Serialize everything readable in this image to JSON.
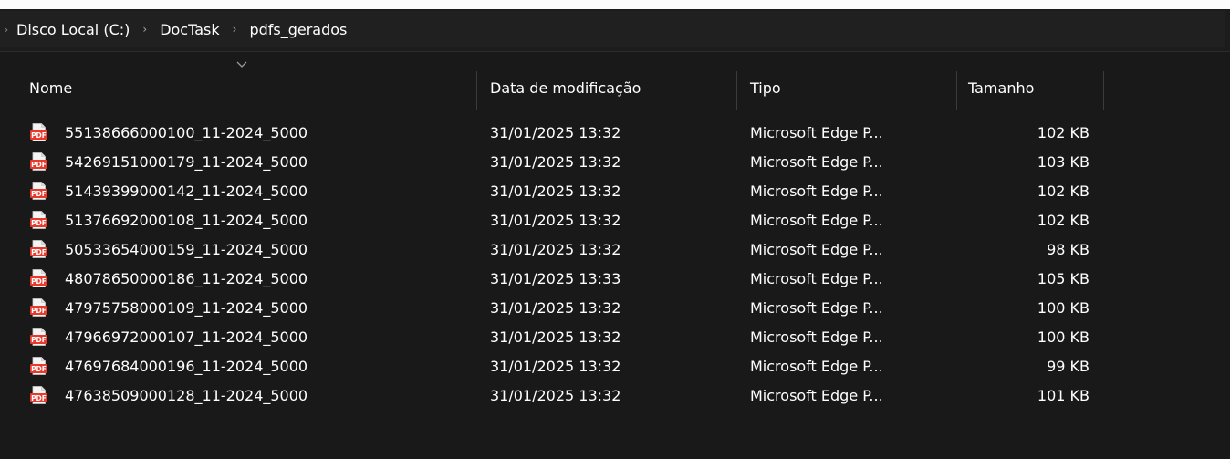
{
  "breadcrumb": {
    "items": [
      "Disco Local (C:)",
      "DocTask",
      "pdfs_gerados"
    ]
  },
  "columns": {
    "name": "Nome",
    "modified": "Data de modificação",
    "type": "Tipo",
    "size": "Tamanho"
  },
  "icons": {
    "file_icon": "pdf-file-icon",
    "file_icon_label": "PDF",
    "file_icon_color": "#e8392b"
  },
  "files": [
    {
      "name": "55138666000100_11-2024_5000",
      "modified": "31/01/2025 13:32",
      "type": "Microsoft Edge P...",
      "size": "102 KB"
    },
    {
      "name": "54269151000179_11-2024_5000",
      "modified": "31/01/2025 13:32",
      "type": "Microsoft Edge P...",
      "size": "103 KB"
    },
    {
      "name": "51439399000142_11-2024_5000",
      "modified": "31/01/2025 13:32",
      "type": "Microsoft Edge P...",
      "size": "102 KB"
    },
    {
      "name": "51376692000108_11-2024_5000",
      "modified": "31/01/2025 13:32",
      "type": "Microsoft Edge P...",
      "size": "102 KB"
    },
    {
      "name": "50533654000159_11-2024_5000",
      "modified": "31/01/2025 13:32",
      "type": "Microsoft Edge P...",
      "size": "98 KB"
    },
    {
      "name": "48078650000186_11-2024_5000",
      "modified": "31/01/2025 13:33",
      "type": "Microsoft Edge P...",
      "size": "105 KB"
    },
    {
      "name": "47975758000109_11-2024_5000",
      "modified": "31/01/2025 13:32",
      "type": "Microsoft Edge P...",
      "size": "100 KB"
    },
    {
      "name": "47966972000107_11-2024_5000",
      "modified": "31/01/2025 13:32",
      "type": "Microsoft Edge P...",
      "size": "100 KB"
    },
    {
      "name": "47697684000196_11-2024_5000",
      "modified": "31/01/2025 13:32",
      "type": "Microsoft Edge P...",
      "size": "99 KB"
    },
    {
      "name": "47638509000128_11-2024_5000",
      "modified": "31/01/2025 13:32",
      "type": "Microsoft Edge P...",
      "size": "101 KB"
    }
  ]
}
